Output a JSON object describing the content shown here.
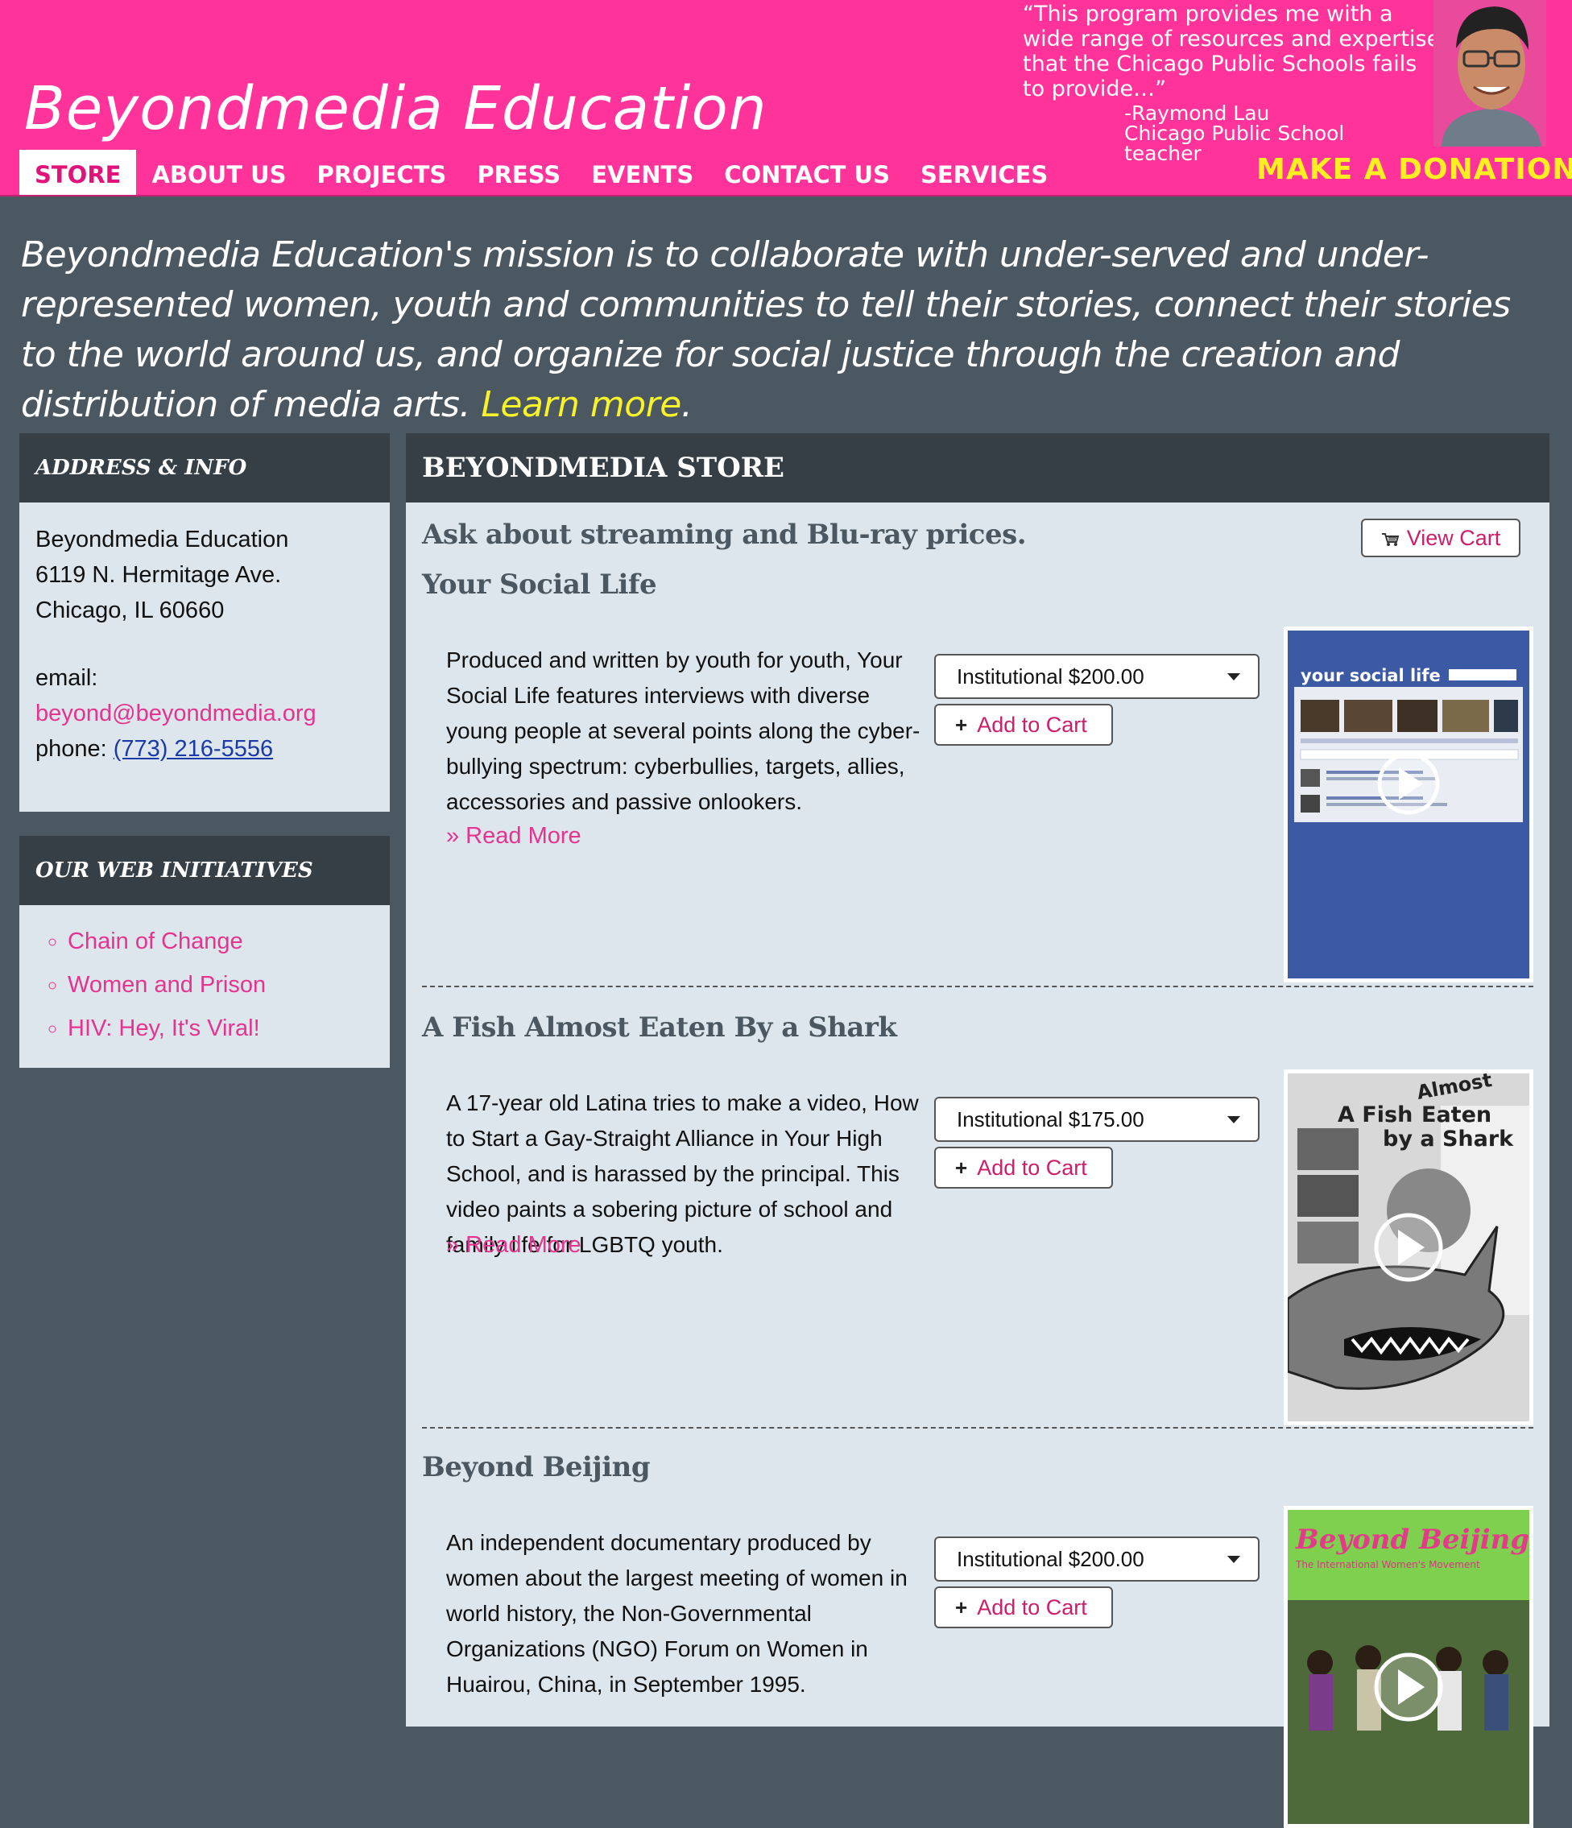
{
  "header": {
    "brand": "Beyondmedia Education",
    "quote": "“This program provides me with a wide range of resources and expertise that the Chicago Public Schools fails to provide…”",
    "quote_name": "-Raymond Lau",
    "quote_role": "Chicago Public School teacher",
    "donate": "MAKE A DONATION",
    "nav": [
      "STORE",
      "ABOUT US",
      "PROJECTS",
      "PRESS",
      "EVENTS",
      "CONTACT US",
      "SERVICES"
    ]
  },
  "mission": {
    "text": "Beyondmedia Education's mission is to collaborate with under-served and under-represented women, youth and communities to tell their stories, connect their stories to the world around us, and organize for social justice through the creation and distribution of media arts. ",
    "link": "Learn more",
    "end": "."
  },
  "sidebar": {
    "address_title": "ADDRESS & INFO",
    "org": "Beyondmedia Education",
    "street": "6119 N. Hermitage Ave.",
    "city": "Chicago, IL 60660",
    "email_label": "email:",
    "email": "beyond@beyondmedia.org",
    "phone_label": "phone: ",
    "phone": "(773) 216-5556",
    "initiatives_title": "OUR WEB INITIATIVES",
    "initiatives": [
      "Chain of Change",
      "Women and Prison",
      "HIV: Hey, It's Viral!"
    ]
  },
  "store": {
    "title": "BEYONDMEDIA STORE",
    "ask": "Ask about streaming and Blu-ray prices.",
    "view_cart": "View Cart",
    "add_to_cart": "Add to Cart",
    "read_more": "» Read More",
    "products": [
      {
        "title": "Your Social Life",
        "description": "Produced and written by youth for youth, Your Social Life features interviews with diverse young people at several points along the cyber-bullying spectrum: cyberbullies, targets, allies, accessories and passive onlookers.",
        "price_option": "Institutional $200.00",
        "thumb_text": "your social life",
        "thumb_bg": "#3b5aa3"
      },
      {
        "title": "A Fish Almost Eaten By a Shark",
        "description": "A 17-year old Latina tries to make a video, How to Start a Gay-Straight Alliance in Your High School, and is harassed by the principal.  This video paints a sobering picture of school and family life for LGBTQ youth.",
        "price_option": "Institutional $175.00",
        "thumb_line1": "A Fish",
        "thumb_almost": "Almost",
        "thumb_line2": "Eaten",
        "thumb_line3": "by a Shark",
        "thumb_bg": "#d8d8d8"
      },
      {
        "title": "Beyond Beijing",
        "description": "An independent documentary produced by women about the largest meeting of women in world history, the Non-Governmental Organizations (NGO) Forum on Women in Huairou, China, in September 1995.",
        "price_option": "Institutional $200.00",
        "thumb_text": "Beyond Beijing",
        "thumb_sub": "The International Women's Movement",
        "thumb_bg": "#7ed04e"
      }
    ]
  },
  "colors": {
    "header_pink": "#ff3399",
    "link_pink": "#e5348e",
    "donate_yellow": "#ffee22",
    "learn_more_yellow": "#f7f22a",
    "page_bg": "#4c5861",
    "panel_dark": "#363f45",
    "panel_light": "#dde6ec"
  }
}
